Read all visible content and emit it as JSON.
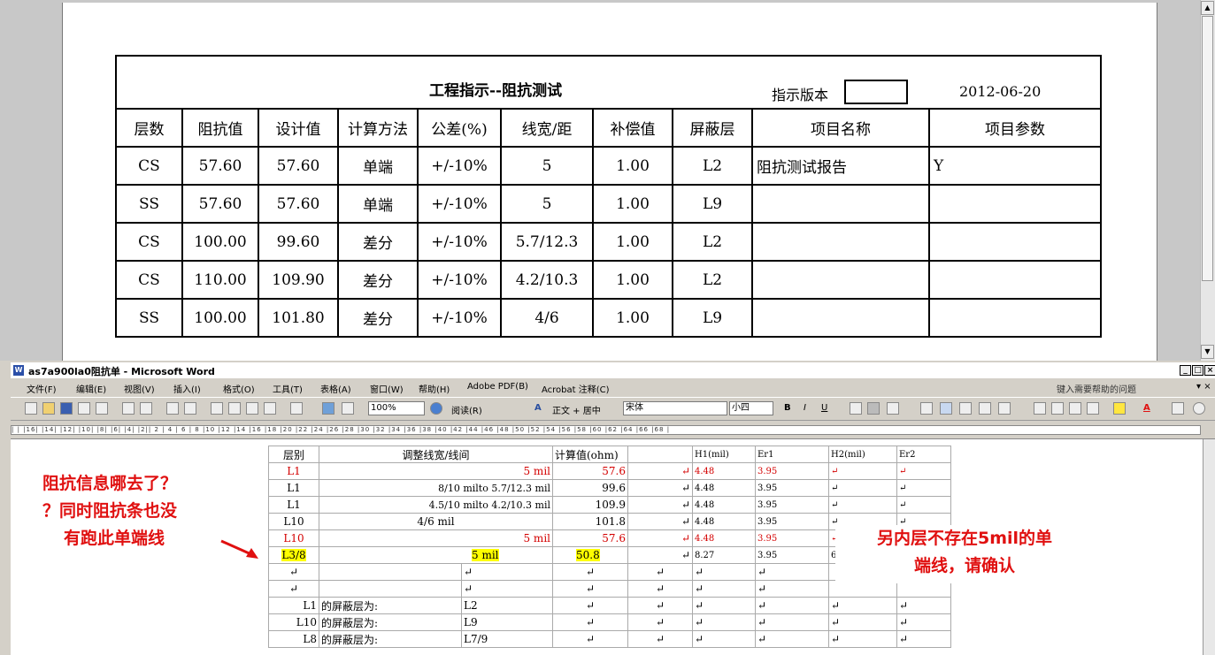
{
  "top_doc": {
    "title": "工程指示--阻抗测试",
    "version_label": "指示版本",
    "date": "2012-06-20",
    "headers": [
      "层数",
      "阻抗值",
      "设计值",
      "计算方法",
      "公差(%)",
      "线宽/距",
      "补偿值",
      "屏蔽层",
      "项目名称",
      "项目参数"
    ],
    "rows": [
      [
        "CS",
        "57.60",
        "57.60",
        "单端",
        "+/-10%",
        "5",
        "1.00",
        "L2",
        "阻抗测试报告",
        "Y"
      ],
      [
        "SS",
        "57.60",
        "57.60",
        "单端",
        "+/-10%",
        "5",
        "1.00",
        "L9",
        "",
        ""
      ],
      [
        "CS",
        "100.00",
        "99.60",
        "差分",
        "+/-10%",
        "5.7/12.3",
        "1.00",
        "L2",
        "",
        ""
      ],
      [
        "CS",
        "110.00",
        "109.90",
        "差分",
        "+/-10%",
        "4.2/10.3",
        "1.00",
        "L2",
        "",
        ""
      ],
      [
        "SS",
        "100.00",
        "101.80",
        "差分",
        "+/-10%",
        "4/6",
        "1.00",
        "L9",
        "",
        ""
      ]
    ]
  },
  "word": {
    "window_title": "as7a900la0阻抗单 - Microsoft Word",
    "menu": [
      "文件(F)",
      "编辑(E)",
      "视图(V)",
      "插入(I)",
      "格式(O)",
      "工具(T)",
      "表格(A)",
      "窗口(W)",
      "帮助(H)",
      "Adobe PDF(B)",
      "Acrobat 注释(C)"
    ],
    "help_placeholder": "键入需要帮助的问题",
    "zoom": "100%",
    "read_label": "阅读(R)",
    "style": "正文 + 居中",
    "font": "宋体",
    "size": "小四",
    "ruler_text": "| 2 | 4 | 6 | 8 |10 |12 |14 |16 |18 |20 |22 |24 |26 |28 |30 |32 |34 |36 |38 |40 |42 |44 |46 |48 |50 |52 |54 |56 |58 |60 |62 |64 |66 |68 |",
    "ruler_left_text": "| | |16| |14| |12| |10| |8| |6| |4| |2|",
    "table_header": [
      "层别",
      "调整线宽/线间",
      "计算值(ohm)",
      "H1(mil)",
      "Er1",
      "H2(mil)",
      "Er2"
    ],
    "table_rows": [
      {
        "layer": "L1",
        "adjust": "5 mil",
        "calc": "57.6",
        "h1": "4.48",
        "er1": "3.95",
        "style": "red"
      },
      {
        "layer": "L1",
        "adjust": "8/10 milto 5.7/12.3 mil",
        "calc": "99.6",
        "h1": "4.48",
        "er1": "3.95",
        "style": "normal"
      },
      {
        "layer": "L1",
        "adjust": "4.5/10 milto 4.2/10.3 mil",
        "calc": "109.9",
        "h1": "4.48",
        "er1": "3.95",
        "style": "normal"
      },
      {
        "layer": "L10",
        "adjust": "4/6 mil",
        "calc": "101.8",
        "h1": "4.48",
        "er1": "3.95",
        "style": "normal"
      },
      {
        "layer": "L10",
        "adjust": "5 mil",
        "calc": "57.6",
        "h1": "4.48",
        "er1": "3.95",
        "style": "red"
      },
      {
        "layer": "L3/8",
        "adjust": "5 mil",
        "calc": "50.8",
        "h1": "8.27",
        "er1": "3.95",
        "h2": "6.",
        "style": "highlight"
      }
    ],
    "shield_rows": [
      {
        "layer": "L1",
        "label": "的屏蔽层为:",
        "value": "L2"
      },
      {
        "layer": "L10",
        "label": "的屏蔽层为:",
        "value": "L9"
      },
      {
        "layer": "L8",
        "label": "的屏蔽层为:",
        "value": "L7/9"
      }
    ],
    "para_mark": "↵"
  },
  "annotations": {
    "left_lines": [
      "阻抗信息哪去了？",
      "？同时阻抗条也没",
      "有跑此单端线"
    ],
    "right_lines": [
      "另内层不存在5mil的单",
      "端线，请确认"
    ],
    "color": "#e01010"
  }
}
